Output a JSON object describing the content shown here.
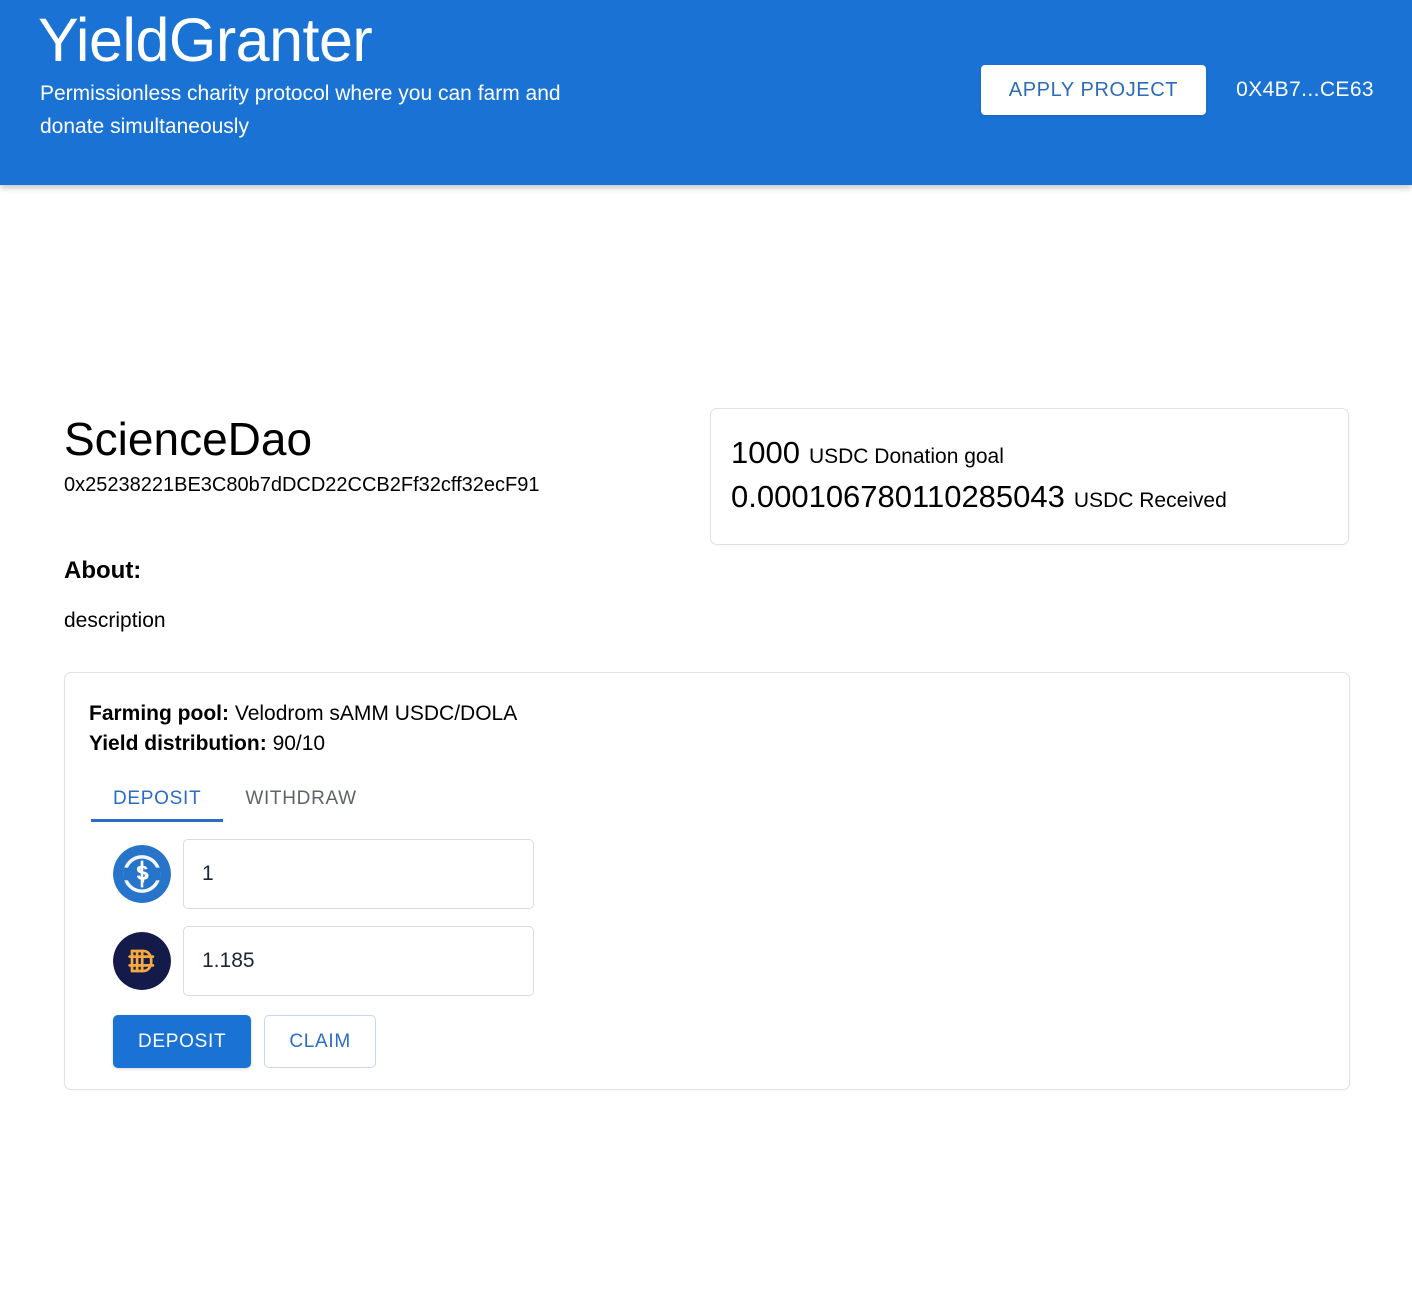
{
  "header": {
    "brand_title": "YieldGranter",
    "brand_subtitle": "Permissionless charity protocol where you can farm and donate simultaneously",
    "apply_button": "APPLY PROJECT",
    "wallet_address": "0X4B7...CE63",
    "background_color": "#1a73d4"
  },
  "project": {
    "name": "ScienceDao",
    "address": "0x25238221BE3C80b7dDCD22CCB2Ff32cff32ecF91"
  },
  "donation": {
    "goal_amount": "1000",
    "goal_label": "USDC Donation goal",
    "received_amount": "0.000106780110285043",
    "received_label": "USDC Received"
  },
  "about": {
    "title": "About:",
    "description": "description"
  },
  "farming": {
    "pool_label": "Farming pool:",
    "pool_value": "Velodrom sAMM USDC/DOLA",
    "yield_label": "Yield distribution:",
    "yield_value": "90/10",
    "tabs": [
      {
        "label": "DEPOSIT",
        "active": true
      },
      {
        "label": "WITHDRAW",
        "active": false
      }
    ],
    "fields": [
      {
        "icon": "usdc-token-icon",
        "token": "USDC",
        "value": "1"
      },
      {
        "icon": "dola-token-icon",
        "token": "DOLA",
        "value": "1.185"
      }
    ],
    "deposit_button": "DEPOSIT",
    "claim_button": "CLAIM",
    "accent_color": "#1a73d4",
    "tab_active_color": "#2a6cc7"
  }
}
